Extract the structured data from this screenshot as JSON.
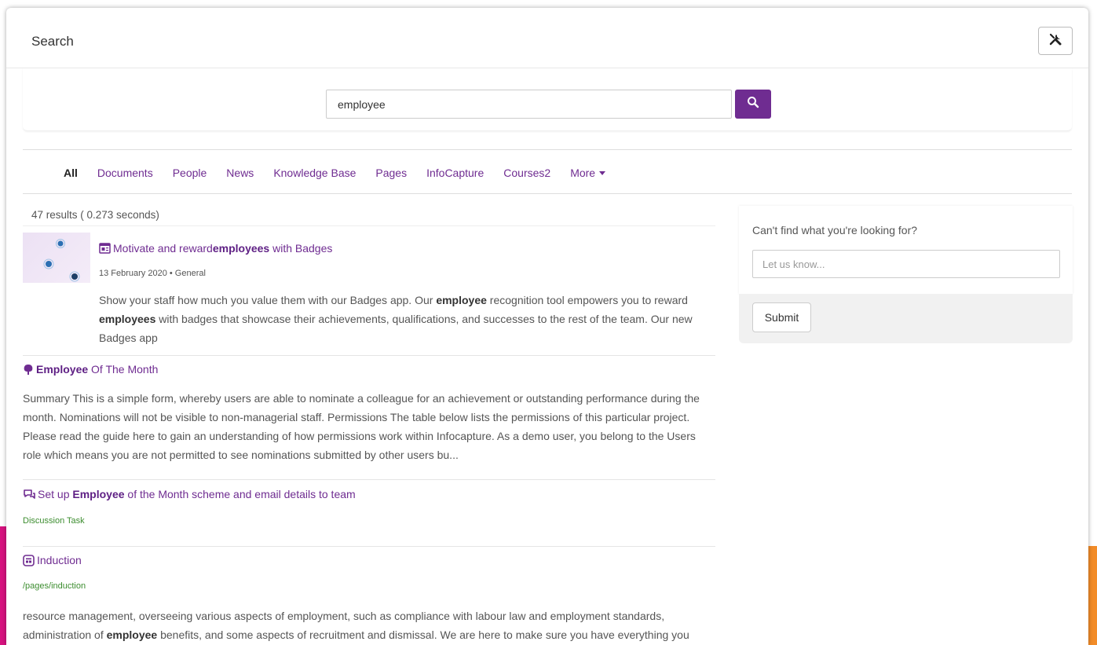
{
  "modal": {
    "title": "Search"
  },
  "search": {
    "query": "employee",
    "button_icon": "search-icon"
  },
  "tabs": [
    {
      "label": "All",
      "active": true
    },
    {
      "label": "Documents"
    },
    {
      "label": "People"
    },
    {
      "label": "News"
    },
    {
      "label": "Knowledge Base"
    },
    {
      "label": "Pages"
    },
    {
      "label": "InfoCapture"
    },
    {
      "label": "Courses2"
    },
    {
      "label": "More",
      "has_caret": true
    }
  ],
  "results_summary": "47 results ( 0.273 seconds)",
  "results": [
    {
      "icon": "news-icon",
      "title_pre": "Motivate and reward ",
      "title_bold": "employees",
      "title_post": " with Badges",
      "meta": "13 February 2020 • General",
      "snippet": [
        {
          "t": "Show your staff how much you value them with our Badges app. Our "
        },
        {
          "b": "employee"
        },
        {
          "t": " recognition tool empowers you to reward "
        },
        {
          "b": "employees"
        },
        {
          "t": " with badges that showcase their achievements, qualifications, and successes to the rest of the team. Our new Badges app"
        }
      ]
    },
    {
      "icon": "tree-icon",
      "title_pre": "",
      "title_bold": "Employee",
      "title_post": " Of The Month",
      "snippet": [
        {
          "t": "Summary This is a simple form, whereby users are able to nominate a colleague for an achievement or outstanding performance during the month. Nominations will not be visible to non-managerial staff. Permissions The table below lists the permissions of this particular project. Please read the guide here to gain an understanding of how permissions work within Infocapture. As a demo user, you belong to the Users role which means you are not permitted to see nominations submitted by other users bu..."
        }
      ]
    },
    {
      "icon": "discussion-icon",
      "title_pre": "Set up ",
      "title_bold": "Employee",
      "title_post": " of the Month scheme and email details to team",
      "subtitle": "Discussion Task"
    },
    {
      "icon": "page-icon",
      "title_pre": "Induction",
      "title_bold": "",
      "title_post": "",
      "subtitle": "/pages/induction",
      "snippet": [
        {
          "t": "resource management, overseeing various aspects of employment, such as compliance with labour law and employment standards, administration of "
        },
        {
          "b": "employee"
        },
        {
          "t": " benefits, and some aspects of recruitment and dismissal. We are here to make sure you have everything you need at the very beginning..."
        }
      ]
    }
  ],
  "feedback": {
    "question": "Can't find what you're looking for?",
    "placeholder": "Let us know...",
    "submit_label": "Submit"
  },
  "colors": {
    "brand_purple": "#6f2c91",
    "link_green": "#3c8d2f",
    "accent_pink": "#d6127f",
    "accent_orange": "#f28c28"
  }
}
